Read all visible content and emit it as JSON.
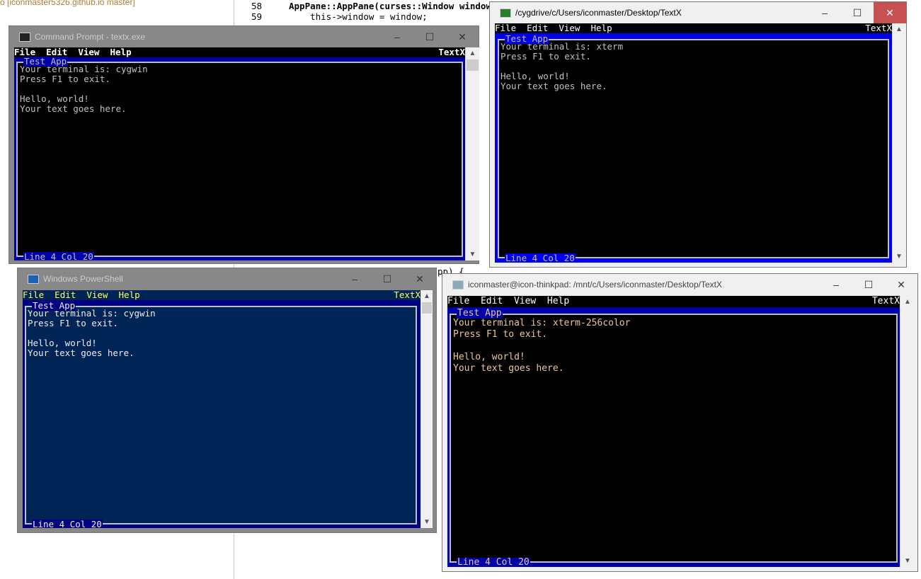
{
  "background": {
    "git_label": "o [iconmaster5326.github.io master]",
    "code_lines": [
      {
        "num": "58",
        "text": "AppPane::AppPane(curses::Window window) {"
      },
      {
        "num": "59",
        "text": "    this->window = window;"
      }
    ],
    "fragment": "pp) {"
  },
  "windows": [
    {
      "title": "Command Prompt - textx.exe",
      "menu": [
        "File",
        "Edit",
        "View",
        "Help"
      ],
      "brand": "TextX",
      "box_title": "Test App",
      "lines": [
        "Your terminal is: cygwin",
        "Press F1 to exit.",
        "",
        "Hello, world!",
        "Your text goes here."
      ],
      "status": "Line 4  Col 20",
      "minimize": "–",
      "maximize": "☐",
      "close": "✕"
    },
    {
      "title": "/cygdrive/c/Users/iconmaster/Desktop/TextX",
      "menu": [
        "File",
        "Edit",
        "View",
        "Help"
      ],
      "brand": "TextX",
      "box_title": "Test App",
      "lines": [
        "Your terminal is: xterm",
        "Press F1 to exit.",
        "",
        "Hello, world!",
        "Your text goes here."
      ],
      "status": "Line 4  Col 20",
      "minimize": "–",
      "maximize": "☐",
      "close": "✕"
    },
    {
      "title": "Windows PowerShell",
      "menu": [
        "File",
        "Edit",
        "View",
        "Help"
      ],
      "brand": "TextX",
      "box_title": "Test App",
      "lines": [
        "Your terminal is: cygwin",
        "Press F1 to exit.",
        "",
        "Hello, world!",
        "Your text goes here."
      ],
      "status": "Line 4  Col 20",
      "minimize": "–",
      "maximize": "☐",
      "close": "✕"
    },
    {
      "title": "iconmaster@icon-thinkpad: /mnt/c/Users/iconmaster/Desktop/TextX",
      "menu": [
        "File",
        "Edit",
        "View",
        "Help"
      ],
      "brand": "TextX",
      "box_title": "Test App",
      "lines": [
        "Your terminal is: xterm-256color",
        "Press F1 to exit.",
        "",
        "Hello, world!",
        "Your text goes here."
      ],
      "status": "Line 4  Col 20",
      "minimize": "–",
      "maximize": "☐",
      "close": "✕"
    }
  ],
  "colors": {
    "frame": "#0000a8",
    "cmd_bg": "#000000",
    "ps_bg": "#012456",
    "ps_menu": "#ffff60",
    "wsl_text": "#e8c89a"
  }
}
